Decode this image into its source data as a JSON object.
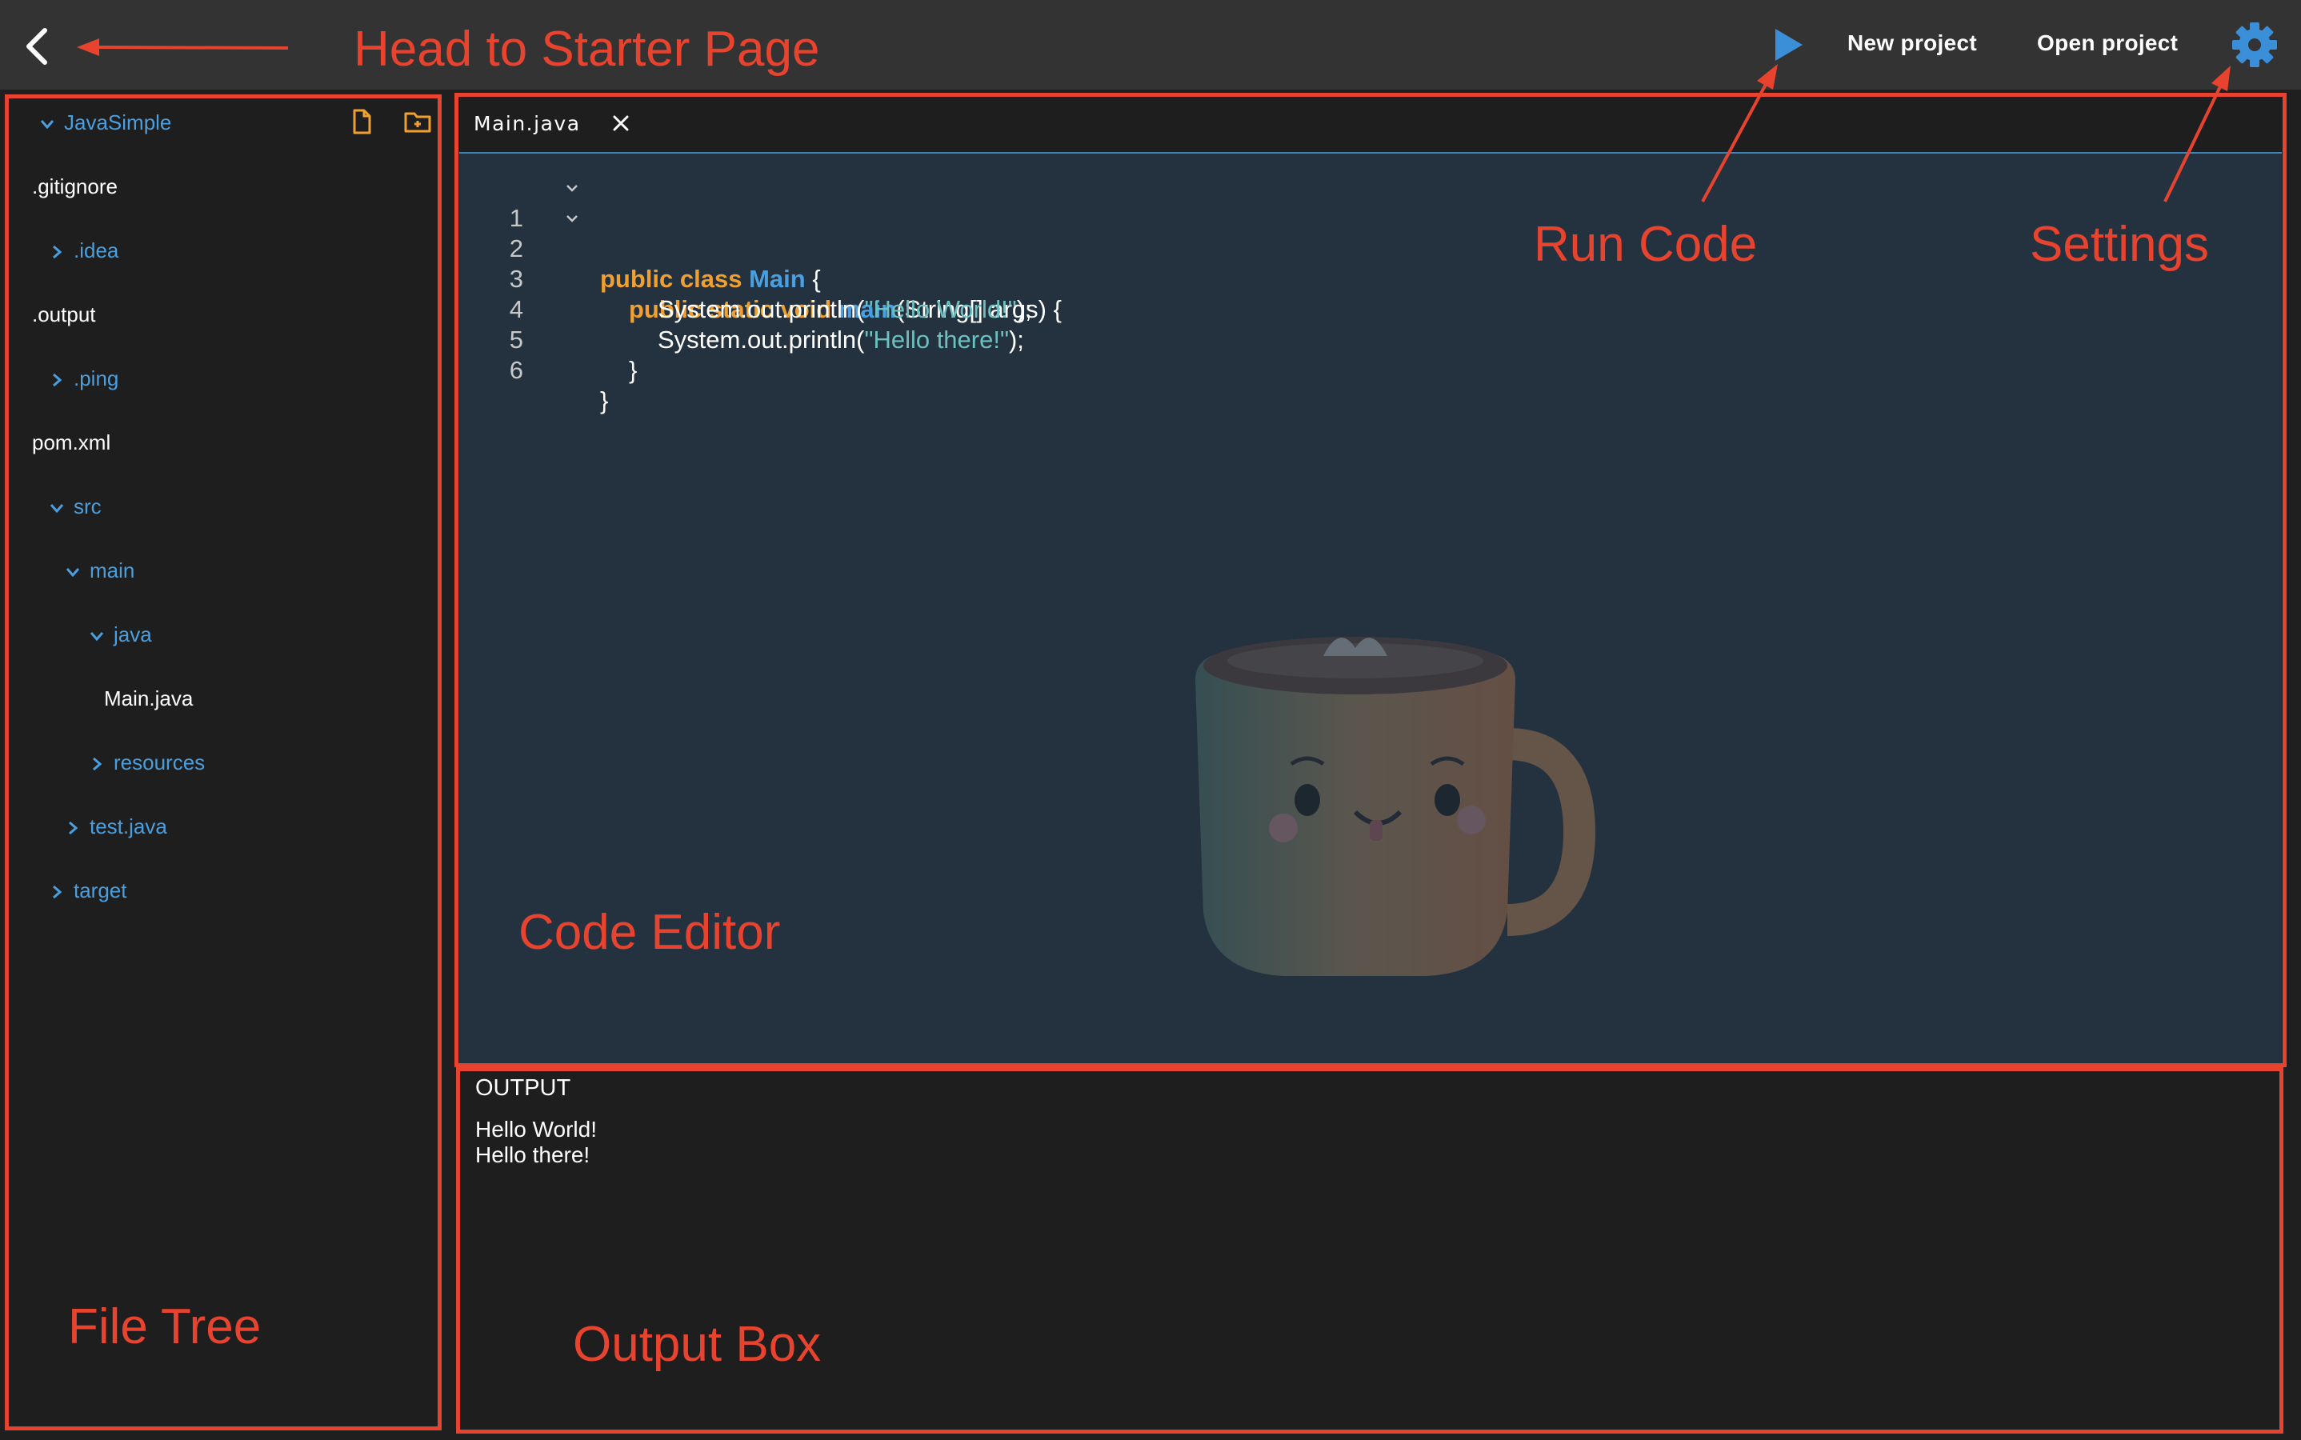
{
  "topbar": {
    "new_project": "New project",
    "open_project": "Open project"
  },
  "filetree": {
    "items": [
      {
        "label": "JavaSimple",
        "type": "folder-open"
      },
      {
        "label": ".gitignore",
        "type": "file"
      },
      {
        "label": ".idea",
        "type": "folder-closed"
      },
      {
        "label": ".output",
        "type": "file"
      },
      {
        "label": ".ping",
        "type": "folder-closed"
      },
      {
        "label": "pom.xml",
        "type": "file"
      },
      {
        "label": "src",
        "type": "folder-open"
      },
      {
        "label": "main",
        "type": "folder-open"
      },
      {
        "label": "java",
        "type": "folder-open"
      },
      {
        "label": "Main.java",
        "type": "file"
      },
      {
        "label": "resources",
        "type": "folder-closed"
      },
      {
        "label": "test.java",
        "type": "folder-closed"
      },
      {
        "label": "target",
        "type": "folder-closed"
      }
    ]
  },
  "editor": {
    "tab_label": "Main.java",
    "lines": [
      {
        "n": "1"
      },
      {
        "n": "2"
      },
      {
        "n": "3"
      },
      {
        "n": "4"
      },
      {
        "n": "5"
      },
      {
        "n": "6"
      }
    ],
    "code": {
      "l1_kw": "public class ",
      "l1_cls": "Main",
      "l1_rest": " {",
      "l2_kw": "public static void ",
      "l2_cls": "main",
      "l2_rest": "(String[] args) {",
      "l3_pre": "System.out.println(",
      "l3_str": "\"Hello World!\"",
      "l3_post": ");",
      "l4_pre": "System.out.println(",
      "l4_str": "\"Hello there!\"",
      "l4_post": ");",
      "l5": "}",
      "l6": "}"
    }
  },
  "output": {
    "title": "OUTPUT",
    "lines": [
      "Hello World!",
      "Hello there!"
    ]
  },
  "annotations": {
    "starter": "Head to Starter Page",
    "run": "Run Code",
    "settings": "Settings",
    "editor": "Code Editor",
    "filetree": "File Tree",
    "output": "Output Box"
  },
  "colors": {
    "accent_blue": "#4a9fe0",
    "keyword_orange": "#f0a030",
    "string_teal": "#6cc0c0",
    "annotation_red": "#e8432e",
    "topbar_bg": "#333333",
    "editor_bg": "#243240"
  },
  "icons": {
    "back": "chevron-left-icon",
    "run": "play-icon",
    "settings": "gear-icon",
    "new_file": "new-file-icon",
    "new_folder": "new-folder-icon",
    "close_tab": "close-icon"
  }
}
